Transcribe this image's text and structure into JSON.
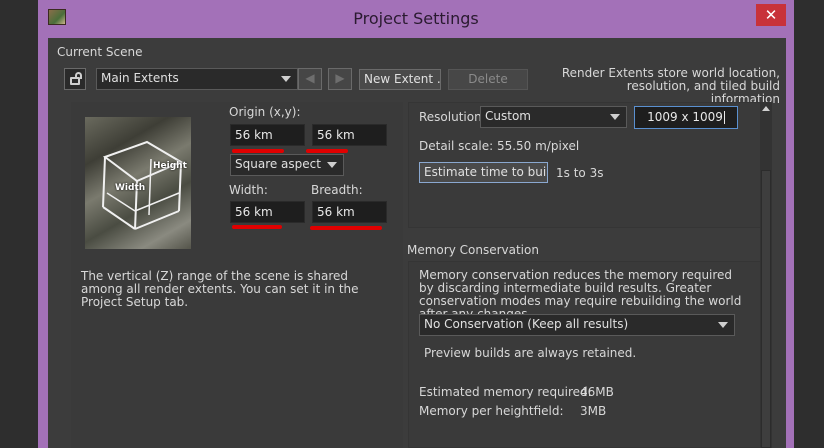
{
  "window": {
    "title": "Project Settings",
    "close_glyph": "✕"
  },
  "scene": {
    "section_label": "Current Scene",
    "lock_glyph": "🔓",
    "selected_extent": "Main Extents",
    "prev_glyph": "◀",
    "next_glyph": "▶",
    "new_extent_label": "New Extent ...",
    "delete_label": "Delete",
    "info_text": "Render Extents store world location, resolution, and tiled build information"
  },
  "extents": {
    "origin_label": "Origin (x,y):",
    "origin_x": "56 km",
    "origin_y": "56 km",
    "aspect_value": "Square aspect",
    "width_label": "Width:",
    "width_value": "56 km",
    "breadth_label": "Breadth:",
    "breadth_value": "56 km",
    "diagram_height_label": "Height",
    "diagram_width_label": "Width",
    "z_range_note": "The vertical (Z) range of the scene is shared among all render extents. You can set it in the Project Setup tab."
  },
  "resolution": {
    "label": "Resolution",
    "preset_value": "Custom",
    "value": "1009 x 1009",
    "detail_scale": "Detail scale:  55.50 m/pixel",
    "estimate_button": "Estimate time to build...",
    "estimate_result": "1s to 3s"
  },
  "memory": {
    "section_label": "Memory Conservation",
    "description": "Memory conservation reduces the memory required by discarding intermediate build results. Greater conservation modes may require rebuilding the world after any changes.",
    "mode_value": "No Conservation (Keep all results)",
    "preview_note": "Preview builds are always retained.",
    "estimated_label": "Estimated memory required:",
    "estimated_value": "46MB",
    "per_hf_label": "Memory per heightfield:",
    "per_hf_value": "3MB"
  }
}
